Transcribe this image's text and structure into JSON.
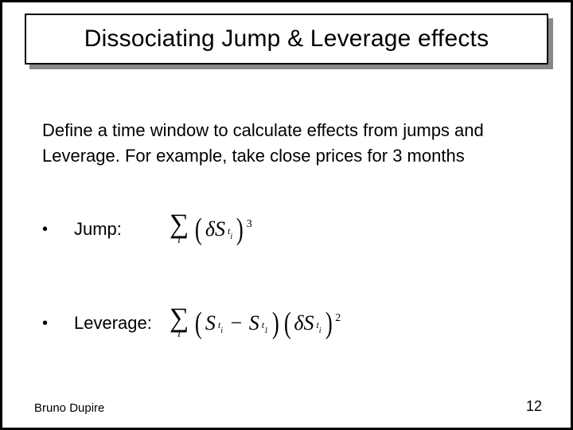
{
  "title": "Dissociating Jump & Leverage effects",
  "body": "Define a time window to calculate effects from jumps and Leverage. For example, take close prices for 3 months",
  "bullets": {
    "jump": {
      "label": "Jump:",
      "formula_text": "∑_i (δS_{t_i})^3"
    },
    "leverage": {
      "label": "Leverage:",
      "formula_text": "∑_i (S_{t_i} − S_{t_1}) (δS_{t_i})^2"
    }
  },
  "footer": {
    "author": "Bruno Dupire",
    "page": "12"
  }
}
